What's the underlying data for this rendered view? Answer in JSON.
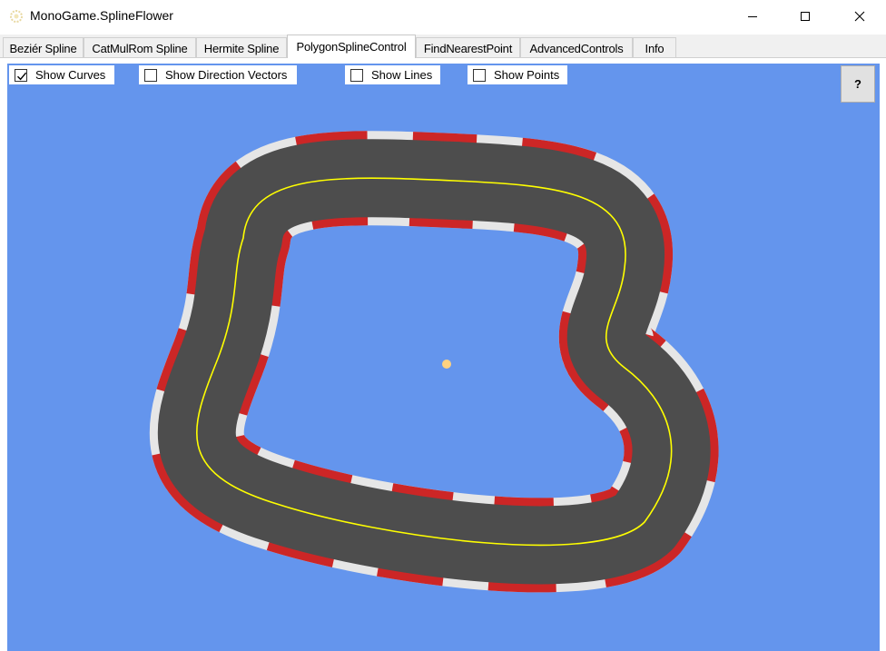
{
  "window": {
    "title": "MonoGame.SplineFlower",
    "app_icon": "gear-flower-icon",
    "controls": [
      "minimize-icon",
      "maximize-icon",
      "close-icon"
    ]
  },
  "tabs": [
    {
      "label": "Beziér Spline",
      "active": false
    },
    {
      "label": "CatMulRom Spline",
      "active": false
    },
    {
      "label": "Hermite Spline",
      "active": false
    },
    {
      "label": "PolygonSplineControl",
      "active": true
    },
    {
      "label": "FindNearestPoint",
      "active": false
    },
    {
      "label": "AdvancedControls",
      "active": false
    },
    {
      "label": "Info",
      "active": false
    }
  ],
  "options": {
    "show_curves": {
      "label": "Show Curves",
      "checked": true
    },
    "show_direction_vectors": {
      "label": "Show Direction Vectors",
      "checked": false
    },
    "show_lines": {
      "label": "Show Lines",
      "checked": false
    },
    "show_points": {
      "label": "Show Points",
      "checked": false
    }
  },
  "help_button": {
    "label": "?"
  },
  "colors": {
    "canvas_background": "#6495ed",
    "track_surface": "#4d4d4d",
    "curb_red": "#cc2626",
    "curb_white": "#e6e6e6",
    "center_line": "#ffff00",
    "center_point": "#ffd27f"
  }
}
